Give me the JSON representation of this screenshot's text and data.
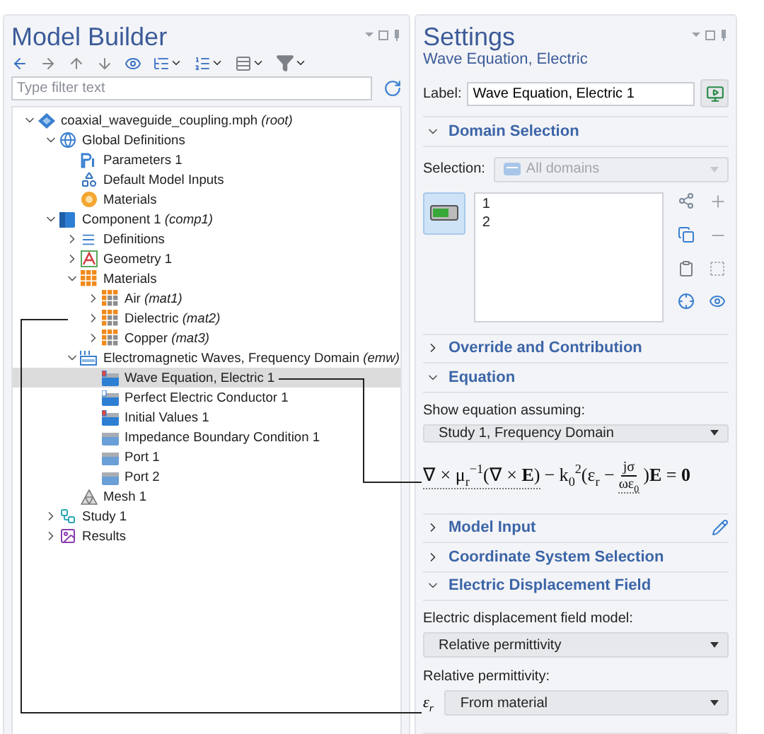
{
  "model_builder": {
    "title": "Model Builder",
    "filter": {
      "placeholder": "Type filter text"
    },
    "tree": [
      {
        "label": "coaxial_waveguide_coupling.mph",
        "tag": "(root)",
        "kind": "file",
        "expanded": true,
        "selected": false,
        "children": [
          {
            "label": "Global Definitions",
            "kind": "globe",
            "expanded": true,
            "selected": false,
            "children": [
              {
                "label": "Parameters 1",
                "kind": "parameters",
                "selected": false
              },
              {
                "label": "Default Model Inputs",
                "kind": "inputs",
                "selected": false
              },
              {
                "label": "Materials",
                "kind": "global_materials",
                "selected": false
              }
            ]
          },
          {
            "label": "Component 1",
            "tag": "(comp1)",
            "kind": "component",
            "expanded": true,
            "selected": false,
            "children": [
              {
                "label": "Definitions",
                "kind": "definitions",
                "expanded": false,
                "selected": false
              },
              {
                "label": "Geometry 1",
                "kind": "geometry",
                "expanded": false,
                "selected": false
              },
              {
                "label": "Materials",
                "kind": "materials",
                "expanded": true,
                "selected": false,
                "children": [
                  {
                    "label": "Air",
                    "tag": "(mat1)",
                    "kind": "material",
                    "expanded": false,
                    "selected": false
                  },
                  {
                    "label": "Dielectric",
                    "tag": "(mat2)",
                    "kind": "material",
                    "expanded": false,
                    "selected": false
                  },
                  {
                    "label": "Copper",
                    "tag": "(mat3)",
                    "kind": "material",
                    "expanded": false,
                    "selected": false
                  }
                ]
              },
              {
                "label": "Electromagnetic Waves, Frequency Domain",
                "tag": "(emw)",
                "kind": "physics",
                "expanded": true,
                "selected": false,
                "children": [
                  {
                    "label": "Wave Equation, Electric 1",
                    "kind": "domain_feature",
                    "selected": true
                  },
                  {
                    "label": "Perfect Electric Conductor 1",
                    "kind": "feature",
                    "selected": false
                  },
                  {
                    "label": "Initial Values 1",
                    "kind": "domain_feature",
                    "selected": false
                  },
                  {
                    "label": "Impedance Boundary Condition 1",
                    "kind": "boundary",
                    "selected": false
                  },
                  {
                    "label": "Port 1",
                    "kind": "boundary",
                    "selected": false
                  },
                  {
                    "label": "Port 2",
                    "kind": "boundary",
                    "selected": false
                  }
                ]
              },
              {
                "label": "Mesh 1",
                "kind": "mesh",
                "selected": false
              }
            ]
          },
          {
            "label": "Study 1",
            "kind": "study",
            "expanded": false,
            "selected": false
          },
          {
            "label": "Results",
            "kind": "results",
            "expanded": false,
            "selected": false
          }
        ]
      }
    ]
  },
  "settings": {
    "title": "Settings",
    "subtitle": "Wave Equation, Electric",
    "label": {
      "caption": "Label:",
      "value": "Wave Equation, Electric 1"
    },
    "sections": [
      {
        "kind": "selection",
        "title": "Domain Selection",
        "expanded": true,
        "caption": "Selection:",
        "dropdown": {
          "value": "All domains",
          "disabled": true
        },
        "active": true,
        "items": [
          "1",
          "2"
        ]
      },
      {
        "kind": "plain",
        "title": "Override and Contribution",
        "expanded": false
      },
      {
        "kind": "equation",
        "title": "Equation",
        "expanded": true,
        "caption": "Show equation assuming:",
        "dropdown": "Study 1, Frequency Domain",
        "equation": {
          "term_1": "∇ × μ$_{r}$$^{−1}$(∇ × **E**)",
          "term_2": "− k$_{0}$$^{2}$(ε$_{r}$ −",
          "numerator": "jσ",
          "denominator": "ωε$_{0}$",
          "term_3": ")**E** = **0**"
        }
      },
      {
        "kind": "input",
        "title": "Model Input",
        "expanded": false
      },
      {
        "kind": "plain",
        "title": "Coordinate System Selection",
        "expanded": false
      },
      {
        "kind": "fields",
        "title": "Electric Displacement Field",
        "expanded": true,
        "fields": [
          {
            "caption": "Electric displacement field model:",
            "value": "Relative permittivity"
          },
          {
            "caption": "Relative permittivity:",
            "symbol": "ε$_{r}$",
            "value": "From material"
          }
        ]
      }
    ]
  }
}
